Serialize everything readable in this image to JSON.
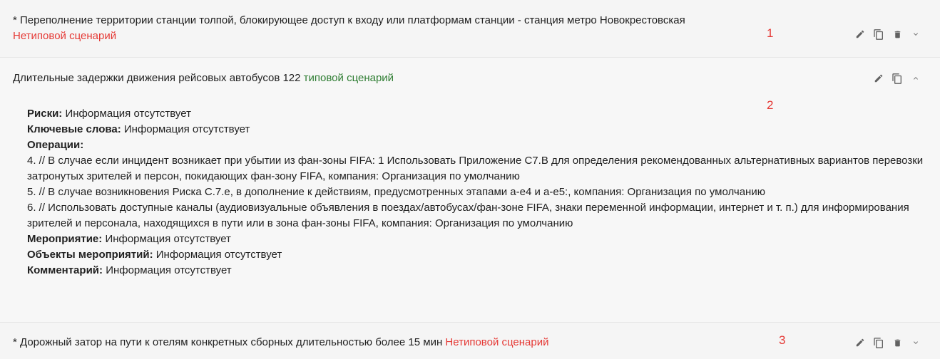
{
  "scenarios": [
    {
      "title": "* Переполнение территории станции толпой, блокирующее доступ к входу или платформам станции - станция метро Новокрестовская",
      "tag": "Нетиповой сценарий",
      "marker": "1"
    },
    {
      "title": "Длительные задержки движения рейсовых автобусов 122",
      "tag": "типовой сценарий",
      "marker": "2",
      "details": {
        "risks_label": "Риски:",
        "risks_value": "Информация отсутствует",
        "keywords_label": "Ключевые слова:",
        "keywords_value": "Информация отсутствует",
        "operations_label": "Операции:",
        "operations": [
          "4. // В случае если инцидент возникает при убытии из фан-зоны FIFA: 1 Использовать Приложение С7.В для определения рекомендованных альтернативных вариантов перевозки затронутых зрителей и персон, покидающих фан-зону FIFA, компания: Организация по умолчанию",
          "5. // В случае возникновения Риска С.7.е, в дополнение к действиям, предусмотренных этапами а-е4 и а-е5:, компания: Организация по умолчанию",
          "6. // Использовать доступные каналы (аудиовизуальные объявления в поездах/автобусах/фан-зоне FIFA, знаки переменной информации, интернет и т. п.) для информирования зрителей и персонала, находящихся в пути или в зона фан-зоны FIFA, компания: Организация по умолчанию"
        ],
        "event_label": "Мероприятие:",
        "event_value": "Информация отсутствует",
        "event_objects_label": "Объекты мероприятий:",
        "event_objects_value": "Информация отсутствует",
        "comment_label": "Комментарий:",
        "comment_value": "Информация отсутствует"
      }
    },
    {
      "title": "* Дорожный затор на пути к отелям конкретных сборных длительностью более 15 мин",
      "tag": "Нетиповой сценарий",
      "marker": "3"
    }
  ],
  "icons": [
    "pencil-icon",
    "copy-icon",
    "trash-icon",
    "chevron-down-icon",
    "chevron-up-icon"
  ],
  "colors": {
    "untyped": "#e53935",
    "typed": "#2e7d32",
    "icon": "#616161"
  }
}
